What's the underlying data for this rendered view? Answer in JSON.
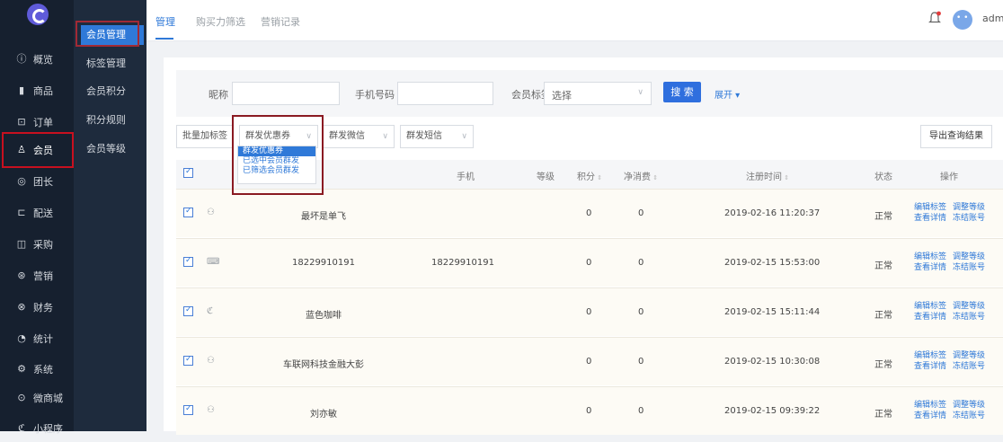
{
  "sidebar": {
    "items": [
      {
        "icon": "info-icon",
        "glyph": "ⓘ",
        "label": "概览"
      },
      {
        "icon": "barcode-icon",
        "glyph": "▮",
        "label": "商品"
      },
      {
        "icon": "cart-icon",
        "glyph": "⊡",
        "label": "订单"
      },
      {
        "icon": "user-icon",
        "glyph": "♙",
        "label": "会员"
      },
      {
        "icon": "team-icon",
        "glyph": "◎",
        "label": "团长"
      },
      {
        "icon": "delivery-icon",
        "glyph": "⊏",
        "label": "配送"
      },
      {
        "icon": "purchase-icon",
        "glyph": "◫",
        "label": "采购"
      },
      {
        "icon": "marketing-icon",
        "glyph": "⊛",
        "label": "营销"
      },
      {
        "icon": "finance-icon",
        "glyph": "⊗",
        "label": "财务"
      },
      {
        "icon": "stats-icon",
        "glyph": "◔",
        "label": "统计"
      },
      {
        "icon": "settings-icon",
        "glyph": "⚙",
        "label": "系统"
      },
      {
        "icon": "mall-icon",
        "glyph": "⊙",
        "label": "微商城"
      },
      {
        "icon": "miniapp-icon",
        "glyph": "ℭ",
        "label": "小程序"
      }
    ]
  },
  "subnav": {
    "items": [
      "会员管理",
      "标签管理",
      "会员积分",
      "积分规则",
      "会员等级"
    ]
  },
  "tabs": [
    "管理",
    "购买力筛选",
    "营销记录"
  ],
  "user": {
    "name": "admi"
  },
  "filter": {
    "nickname_label": "昵称",
    "nickname_value": "",
    "phone_label": "手机号码",
    "phone_value": "",
    "tag_label": "会员标签",
    "tag_value": "选择",
    "search_button": "搜 索",
    "expand": "展开 ▾"
  },
  "toolbar": {
    "batch_tag": "批量加标签",
    "coupon": "群发优惠券",
    "wechat": "群发微信",
    "sms": "群发短信",
    "export": "导出查询结果"
  },
  "dropdown": {
    "options": [
      "群发优惠券",
      "已选中会员群发",
      "已筛选会员群发"
    ]
  },
  "table": {
    "headers": {
      "phone": "手机",
      "level": "等级",
      "points": "积分",
      "net_spend": "净消费",
      "reg_time": "注册时间",
      "status": "状态",
      "actions": "操作"
    },
    "actions": {
      "edit_tag": "编辑标签",
      "adjust_level": "调整等级",
      "detail": "查看详情",
      "freeze": "冻结账号"
    },
    "rows": [
      {
        "source_icon": "wechat-icon",
        "source_glyph": "⚇",
        "nickname": "最坏是单飞",
        "phone": "",
        "level": "",
        "points": "0",
        "net_spend": "0",
        "reg_time": "2019-02-16 11:20:37",
        "status": "正常"
      },
      {
        "source_icon": "keyboard-icon",
        "source_glyph": "⌨",
        "nickname": "18229910191",
        "phone": "18229910191",
        "level": "",
        "points": "0",
        "net_spend": "0",
        "reg_time": "2019-02-15 15:53:00",
        "status": "正常"
      },
      {
        "source_icon": "miniapp-icon",
        "source_glyph": "ℭ",
        "nickname": "蓝色咖啡",
        "phone": "",
        "level": "",
        "points": "0",
        "net_spend": "0",
        "reg_time": "2019-02-15 15:11:44",
        "status": "正常"
      },
      {
        "source_icon": "wechat-icon",
        "source_glyph": "⚇",
        "nickname": "车联网科技金融大彭",
        "phone": "",
        "level": "",
        "points": "0",
        "net_spend": "0",
        "reg_time": "2019-02-15 10:30:08",
        "status": "正常"
      },
      {
        "source_icon": "wechat-icon",
        "source_glyph": "⚇",
        "nickname": "刘亦敏",
        "phone": "",
        "level": "",
        "points": "0",
        "net_spend": "0",
        "reg_time": "2019-02-15 09:39:22",
        "status": "正常"
      }
    ]
  }
}
